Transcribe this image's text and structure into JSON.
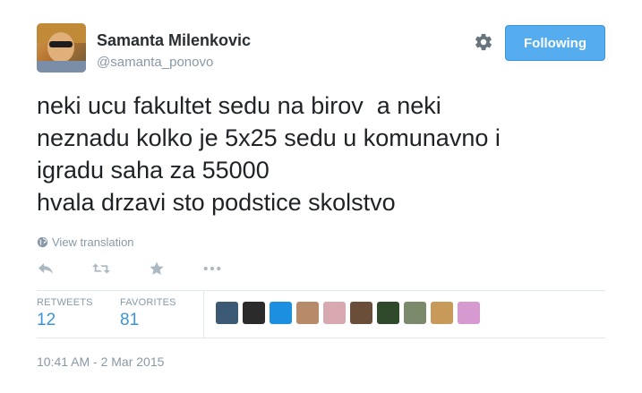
{
  "user": {
    "name": "Samanta Milenkovic",
    "handle": "@samanta_ponovo"
  },
  "follow_button": {
    "label": "Following"
  },
  "tweet": {
    "lines": [
      "neki ucu fakultet sedu na birov  a neki",
      "neznadu kolko je 5x25 sedu u komunavno i",
      "igradu saha za 55000",
      "hvala drzavi sto podstice skolstvo"
    ]
  },
  "translate_label": "View translation",
  "stats": {
    "retweets_label": "RETWEETS",
    "retweets_count": "12",
    "favorites_label": "FAVORITES",
    "favorites_count": "81"
  },
  "favoriters": [
    {
      "name": "avatar-1",
      "color": "#3d5a74"
    },
    {
      "name": "avatar-2",
      "color": "#2b2b2b"
    },
    {
      "name": "avatar-3",
      "color": "#1d8fe0"
    },
    {
      "name": "avatar-4",
      "color": "#b78a6a"
    },
    {
      "name": "avatar-5",
      "color": "#d8a9b0"
    },
    {
      "name": "avatar-6",
      "color": "#6a4e3a"
    },
    {
      "name": "avatar-7",
      "color": "#2f4a2a"
    },
    {
      "name": "avatar-8",
      "color": "#7a8a6a"
    },
    {
      "name": "avatar-9",
      "color": "#c79a5a"
    },
    {
      "name": "avatar-10",
      "color": "#d79ad0"
    }
  ],
  "timestamp": "10:41 AM - 2 Mar 2015",
  "colors": {
    "accent": "#55acee",
    "link": "#3b94d9",
    "muted": "#8899a6"
  }
}
